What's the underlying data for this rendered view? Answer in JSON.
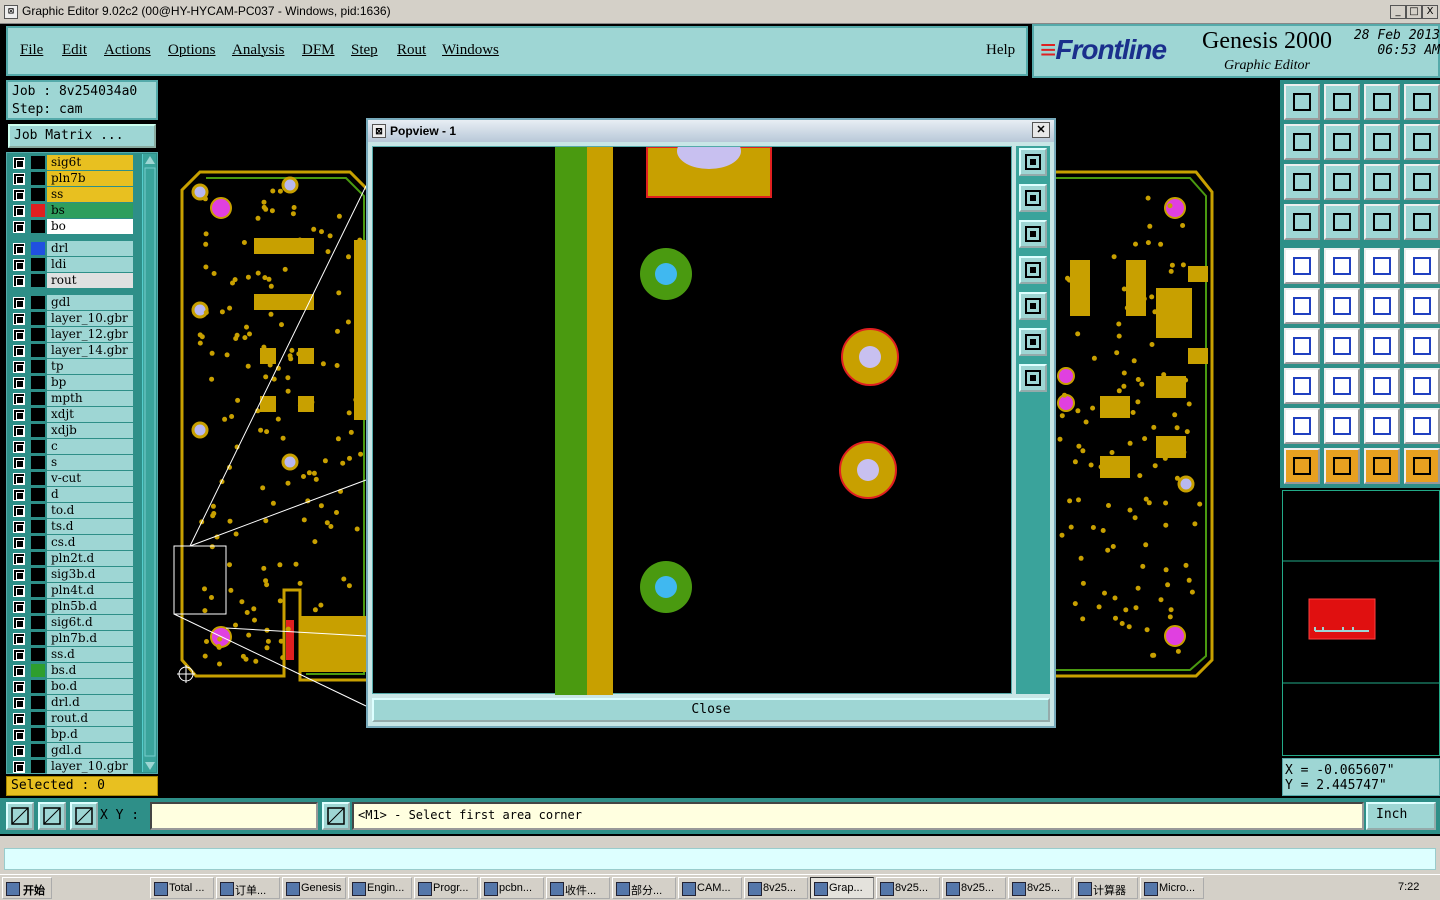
{
  "window": {
    "title": "Graphic Editor 9.02c2 (00@HY-HYCAM-PC037 - Windows, pid:1636)",
    "controls": [
      "_",
      "□",
      "X"
    ]
  },
  "menu": {
    "items": [
      "File",
      "Edit",
      "Actions",
      "Options",
      "Analysis",
      "DFM",
      "Step",
      "Rout",
      "Windows"
    ],
    "help": "Help"
  },
  "brand": {
    "logo": "Frontline",
    "product": "Genesis 2000",
    "subtitle": "Graphic Editor",
    "date": "28 Feb 2013",
    "time": "06:53 AM"
  },
  "job": {
    "job_line": "Job : 8v254034a0",
    "step_line": "Step: cam",
    "matrix_button": "Job Matrix ..."
  },
  "layers": [
    {
      "name": "sig6t",
      "color": "#e8c020",
      "swatch": "#000"
    },
    {
      "name": "pln7b",
      "color": "#e8c020",
      "swatch": "#000"
    },
    {
      "name": "ss",
      "color": "#e8c020",
      "swatch": "#000"
    },
    {
      "name": "bs",
      "color": "#2e9e5e",
      "swatch": "#e02020",
      "selected": true
    },
    {
      "name": "bo",
      "color": "#ffffff",
      "swatch": "#000"
    },
    {
      "name": "drl",
      "color": "#9ed6d4",
      "swatch": "#2050e0"
    },
    {
      "name": "ldi",
      "color": "#9ed6d4",
      "swatch": "#000"
    },
    {
      "name": "rout",
      "color": "#e0e0e0",
      "swatch": "#000"
    },
    {
      "name": "gdl",
      "color": "#9ed6d4",
      "swatch": "#000"
    },
    {
      "name": "layer_10.gbr",
      "color": "#9ed6d4",
      "swatch": "#000"
    },
    {
      "name": "layer_12.gbr",
      "color": "#9ed6d4",
      "swatch": "#000"
    },
    {
      "name": "layer_14.gbr",
      "color": "#9ed6d4",
      "swatch": "#000"
    },
    {
      "name": "tp",
      "color": "#9ed6d4",
      "swatch": "#000"
    },
    {
      "name": "bp",
      "color": "#9ed6d4",
      "swatch": "#000"
    },
    {
      "name": "mpth",
      "color": "#9ed6d4",
      "swatch": "#000"
    },
    {
      "name": "xdjt",
      "color": "#9ed6d4",
      "swatch": "#000"
    },
    {
      "name": "xdjb",
      "color": "#9ed6d4",
      "swatch": "#000"
    },
    {
      "name": "c",
      "color": "#9ed6d4",
      "swatch": "#000"
    },
    {
      "name": "s",
      "color": "#9ed6d4",
      "swatch": "#000"
    },
    {
      "name": "v-cut",
      "color": "#9ed6d4",
      "swatch": "#000"
    },
    {
      "name": "d",
      "color": "#9ed6d4",
      "swatch": "#000"
    },
    {
      "name": "to.d",
      "color": "#9ed6d4",
      "swatch": "#000"
    },
    {
      "name": "ts.d",
      "color": "#9ed6d4",
      "swatch": "#000"
    },
    {
      "name": "cs.d",
      "color": "#9ed6d4",
      "swatch": "#000"
    },
    {
      "name": "pln2t.d",
      "color": "#9ed6d4",
      "swatch": "#000"
    },
    {
      "name": "sig3b.d",
      "color": "#9ed6d4",
      "swatch": "#000"
    },
    {
      "name": "pln4t.d",
      "color": "#9ed6d4",
      "swatch": "#000"
    },
    {
      "name": "pln5b.d",
      "color": "#9ed6d4",
      "swatch": "#000"
    },
    {
      "name": "sig6t.d",
      "color": "#9ed6d4",
      "swatch": "#000"
    },
    {
      "name": "pln7b.d",
      "color": "#9ed6d4",
      "swatch": "#000"
    },
    {
      "name": "ss.d",
      "color": "#9ed6d4",
      "swatch": "#000"
    },
    {
      "name": "bs.d",
      "color": "#9ed6d4",
      "swatch": "#2e9e2e"
    },
    {
      "name": "bo.d",
      "color": "#9ed6d4",
      "swatch": "#000"
    },
    {
      "name": "drl.d",
      "color": "#9ed6d4",
      "swatch": "#000"
    },
    {
      "name": "rout.d",
      "color": "#9ed6d4",
      "swatch": "#000"
    },
    {
      "name": "bp.d",
      "color": "#9ed6d4",
      "swatch": "#000"
    },
    {
      "name": "gdl.d",
      "color": "#9ed6d4",
      "swatch": "#000"
    },
    {
      "name": "layer_10.gbr",
      "color": "#9ed6d4",
      "swatch": "#000"
    }
  ],
  "selected_label": "Selected : 0",
  "popview": {
    "title": "Popview - 1",
    "close_label": "Close"
  },
  "coords": {
    "x": "X = -0.065607\"",
    "y": "Y = 2.445747\""
  },
  "bottom": {
    "xy_label": "X Y :",
    "xy_value": "",
    "message": "<M1> - Select first area corner",
    "unit": "Inch"
  },
  "taskbar": {
    "start": "开始",
    "tasks": [
      "Total ...",
      "订单...",
      "Genesis",
      "Engin...",
      "Progr...",
      "pcbn...",
      "收件...",
      "部分...",
      "CAM...",
      "8v25...",
      "Grap...",
      "8v25...",
      "8v25...",
      "8v25...",
      "计算器",
      "Micro..."
    ],
    "active_index": 10,
    "clock": "7:22"
  },
  "colors": {
    "panel_cyan": "#9ed6d4",
    "panel_teal": "#2e8f88",
    "pcb_gold": "#c8a000",
    "pcb_green": "#4a9a10",
    "pad_pink": "#e040e0"
  }
}
